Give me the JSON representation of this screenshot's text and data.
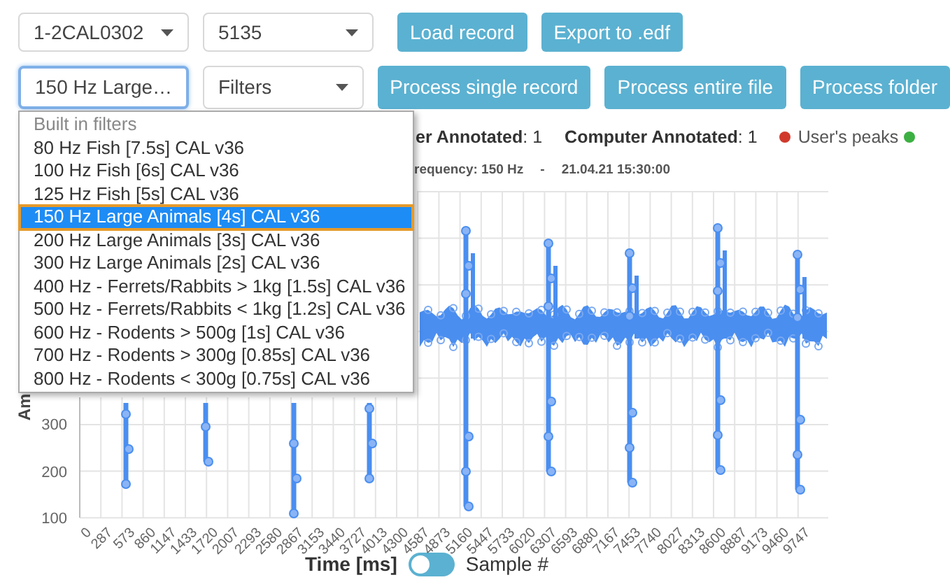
{
  "record_selects": [
    {
      "value": "1-2CAL0302",
      "focused": false
    },
    {
      "value": "5135",
      "focused": false
    }
  ],
  "record_buttons": [
    "Load record",
    "Export to .edf"
  ],
  "filter_selects": [
    {
      "value": "150 Hz Large…",
      "focused": true
    },
    {
      "value": "Filters",
      "focused": false
    }
  ],
  "process_buttons": [
    "Process single record",
    "Process entire file",
    "Process folder"
  ],
  "dropdown": {
    "group": "Built in filters",
    "options": [
      {
        "label": "80 Hz Fish [7.5s] CAL v36",
        "selected": false
      },
      {
        "label": "100 Hz Fish [6s] CAL v36",
        "selected": false
      },
      {
        "label": "125 Hz Fish [5s] CAL v36",
        "selected": false
      },
      {
        "label": "150 Hz Large Animals [4s] CAL v36",
        "selected": true
      },
      {
        "label": "200 Hz Large Animals [3s] CAL v36",
        "selected": false
      },
      {
        "label": "300 Hz Large Animals [2s] CAL v36",
        "selected": false
      },
      {
        "label": "400 Hz - Ferrets/Rabbits > 1kg [1.5s] CAL v36",
        "selected": false
      },
      {
        "label": "500 Hz - Ferrets/Rabbits < 1kg [1.2s] CAL v36",
        "selected": false
      },
      {
        "label": "600 Hz - Rodents > 500g [1s] CAL v36",
        "selected": false
      },
      {
        "label": "700 Hz - Rodents > 300g [0.85s] CAL v36",
        "selected": false
      },
      {
        "label": "800 Hz - Rodents < 300g [0.75s] CAL v36",
        "selected": false
      }
    ]
  },
  "stats": [
    {
      "label": "er Annotated",
      "separator": ":",
      "value": "1"
    },
    {
      "label": "Computer Annotated",
      "separator": ":",
      "value": "1"
    }
  ],
  "legend": [
    {
      "label": "User's peaks",
      "color": "#d0392b"
    },
    {
      "color": "#3cb043"
    }
  ],
  "subtitle": [
    "requency: 150 Hz",
    "-",
    "21.04.21 15:30:00"
  ],
  "chart": {
    "y_label": "Am",
    "y_ticks": [
      "300",
      "200",
      "100"
    ],
    "x_ticks": [
      "0",
      "287",
      "573",
      "860",
      "1147",
      "1433",
      "1720",
      "2007",
      "2293",
      "2580",
      "2867",
      "3153",
      "3440",
      "3727",
      "4013",
      "4300",
      "4587",
      "4873",
      "5160",
      "5447",
      "5733",
      "6020",
      "6307",
      "6593",
      "6880",
      "7167",
      "7453",
      "7740",
      "8027",
      "8313",
      "8600",
      "8887",
      "9173",
      "9460",
      "9747"
    ]
  },
  "axis_toggle": {
    "left_label": "Time [ms]",
    "right_label": "Sample #",
    "on": false
  }
}
